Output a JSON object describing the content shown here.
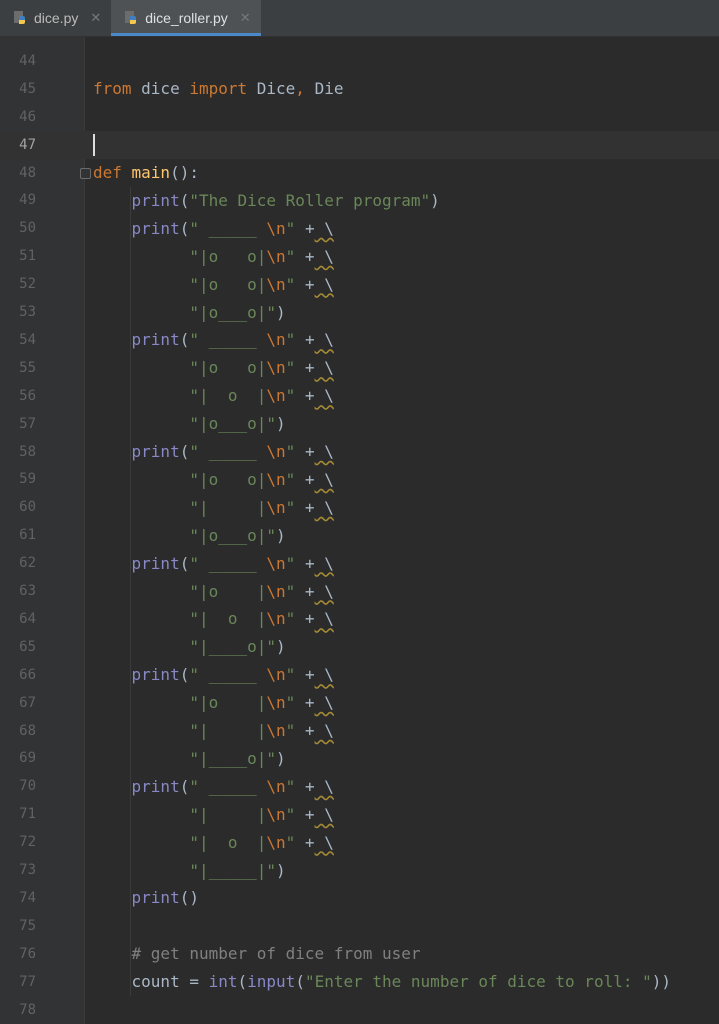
{
  "tabs": [
    {
      "label": "dice.py",
      "active": false,
      "icon": "python-file-icon"
    },
    {
      "label": "dice_roller.py",
      "active": true,
      "icon": "python-file-icon"
    }
  ],
  "colors": {
    "background": "#2b2b2b",
    "keyword": "#cc7832",
    "function": "#ffc66d",
    "builtin": "#8888c6",
    "string": "#6a8759",
    "comment": "#808080",
    "text": "#a9b7c6",
    "tab_accent": "#4a88c7"
  },
  "current_line": 47,
  "lines": [
    {
      "n": "44",
      "t": []
    },
    {
      "n": "45",
      "t": [
        [
          "kw",
          "from"
        ],
        [
          "plain",
          " dice "
        ],
        [
          "kw",
          "import"
        ],
        [
          "plain",
          " Dice"
        ],
        [
          "kw",
          ","
        ],
        [
          "plain",
          " Die"
        ]
      ]
    },
    {
      "n": "46",
      "t": []
    },
    {
      "n": "47",
      "t": []
    },
    {
      "n": "48",
      "t": [
        [
          "kw",
          "def "
        ],
        [
          "fn",
          "main"
        ],
        [
          "plain",
          "():"
        ]
      ]
    },
    {
      "n": "49",
      "t": [
        [
          "plain",
          "    "
        ],
        [
          "bi",
          "print"
        ],
        [
          "plain",
          "("
        ],
        [
          "str",
          "\"The Dice Roller program\""
        ],
        [
          "plain",
          ")"
        ]
      ]
    },
    {
      "n": "50",
      "t": [
        [
          "plain",
          "    "
        ],
        [
          "bi",
          "print"
        ],
        [
          "plain",
          "("
        ],
        [
          "str",
          "\" _____ "
        ],
        [
          "esc",
          "\\n"
        ],
        [
          "str",
          "\" "
        ],
        [
          "plain",
          "+"
        ],
        [
          "warn",
          " \\"
        ]
      ]
    },
    {
      "n": "51",
      "t": [
        [
          "plain",
          "          "
        ],
        [
          "str",
          "\"|o   o|"
        ],
        [
          "esc",
          "\\n"
        ],
        [
          "str",
          "\" "
        ],
        [
          "plain",
          "+"
        ],
        [
          "warn",
          " \\"
        ]
      ]
    },
    {
      "n": "52",
      "t": [
        [
          "plain",
          "          "
        ],
        [
          "str",
          "\"|o   o|"
        ],
        [
          "esc",
          "\\n"
        ],
        [
          "str",
          "\" "
        ],
        [
          "plain",
          "+"
        ],
        [
          "warn",
          " \\"
        ]
      ]
    },
    {
      "n": "53",
      "t": [
        [
          "plain",
          "          "
        ],
        [
          "str",
          "\"|o___o|\""
        ],
        [
          "plain",
          ")"
        ]
      ]
    },
    {
      "n": "54",
      "t": [
        [
          "plain",
          "    "
        ],
        [
          "bi",
          "print"
        ],
        [
          "plain",
          "("
        ],
        [
          "str",
          "\" _____ "
        ],
        [
          "esc",
          "\\n"
        ],
        [
          "str",
          "\" "
        ],
        [
          "plain",
          "+"
        ],
        [
          "warn",
          " \\"
        ]
      ]
    },
    {
      "n": "55",
      "t": [
        [
          "plain",
          "          "
        ],
        [
          "str",
          "\"|o   o|"
        ],
        [
          "esc",
          "\\n"
        ],
        [
          "str",
          "\" "
        ],
        [
          "plain",
          "+"
        ],
        [
          "warn",
          " \\"
        ]
      ]
    },
    {
      "n": "56",
      "t": [
        [
          "plain",
          "          "
        ],
        [
          "str",
          "\"|  o  |"
        ],
        [
          "esc",
          "\\n"
        ],
        [
          "str",
          "\" "
        ],
        [
          "plain",
          "+"
        ],
        [
          "warn",
          " \\"
        ]
      ]
    },
    {
      "n": "57",
      "t": [
        [
          "plain",
          "          "
        ],
        [
          "str",
          "\"|o___o|\""
        ],
        [
          "plain",
          ")"
        ]
      ]
    },
    {
      "n": "58",
      "t": [
        [
          "plain",
          "    "
        ],
        [
          "bi",
          "print"
        ],
        [
          "plain",
          "("
        ],
        [
          "str",
          "\" _____ "
        ],
        [
          "esc",
          "\\n"
        ],
        [
          "str",
          "\" "
        ],
        [
          "plain",
          "+"
        ],
        [
          "warn",
          " \\"
        ]
      ]
    },
    {
      "n": "59",
      "t": [
        [
          "plain",
          "          "
        ],
        [
          "str",
          "\"|o   o|"
        ],
        [
          "esc",
          "\\n"
        ],
        [
          "str",
          "\" "
        ],
        [
          "plain",
          "+"
        ],
        [
          "warn",
          " \\"
        ]
      ]
    },
    {
      "n": "60",
      "t": [
        [
          "plain",
          "          "
        ],
        [
          "str",
          "\"|     |"
        ],
        [
          "esc",
          "\\n"
        ],
        [
          "str",
          "\" "
        ],
        [
          "plain",
          "+"
        ],
        [
          "warn",
          " \\"
        ]
      ]
    },
    {
      "n": "61",
      "t": [
        [
          "plain",
          "          "
        ],
        [
          "str",
          "\"|o___o|\""
        ],
        [
          "plain",
          ")"
        ]
      ]
    },
    {
      "n": "62",
      "t": [
        [
          "plain",
          "    "
        ],
        [
          "bi",
          "print"
        ],
        [
          "plain",
          "("
        ],
        [
          "str",
          "\" _____ "
        ],
        [
          "esc",
          "\\n"
        ],
        [
          "str",
          "\" "
        ],
        [
          "plain",
          "+"
        ],
        [
          "warn",
          " \\"
        ]
      ]
    },
    {
      "n": "63",
      "t": [
        [
          "plain",
          "          "
        ],
        [
          "str",
          "\"|o    |"
        ],
        [
          "esc",
          "\\n"
        ],
        [
          "str",
          "\" "
        ],
        [
          "plain",
          "+"
        ],
        [
          "warn",
          " \\"
        ]
      ]
    },
    {
      "n": "64",
      "t": [
        [
          "plain",
          "          "
        ],
        [
          "str",
          "\"|  o  |"
        ],
        [
          "esc",
          "\\n"
        ],
        [
          "str",
          "\" "
        ],
        [
          "plain",
          "+"
        ],
        [
          "warn",
          " \\"
        ]
      ]
    },
    {
      "n": "65",
      "t": [
        [
          "plain",
          "          "
        ],
        [
          "str",
          "\"|____o|\""
        ],
        [
          "plain",
          ")"
        ]
      ]
    },
    {
      "n": "66",
      "t": [
        [
          "plain",
          "    "
        ],
        [
          "bi",
          "print"
        ],
        [
          "plain",
          "("
        ],
        [
          "str",
          "\" _____ "
        ],
        [
          "esc",
          "\\n"
        ],
        [
          "str",
          "\" "
        ],
        [
          "plain",
          "+"
        ],
        [
          "warn",
          " \\"
        ]
      ]
    },
    {
      "n": "67",
      "t": [
        [
          "plain",
          "          "
        ],
        [
          "str",
          "\"|o    |"
        ],
        [
          "esc",
          "\\n"
        ],
        [
          "str",
          "\" "
        ],
        [
          "plain",
          "+"
        ],
        [
          "warn",
          " \\"
        ]
      ]
    },
    {
      "n": "68",
      "t": [
        [
          "plain",
          "          "
        ],
        [
          "str",
          "\"|     |"
        ],
        [
          "esc",
          "\\n"
        ],
        [
          "str",
          "\" "
        ],
        [
          "plain",
          "+"
        ],
        [
          "warn",
          " \\"
        ]
      ]
    },
    {
      "n": "69",
      "t": [
        [
          "plain",
          "          "
        ],
        [
          "str",
          "\"|____o|\""
        ],
        [
          "plain",
          ")"
        ]
      ]
    },
    {
      "n": "70",
      "t": [
        [
          "plain",
          "    "
        ],
        [
          "bi",
          "print"
        ],
        [
          "plain",
          "("
        ],
        [
          "str",
          "\" _____ "
        ],
        [
          "esc",
          "\\n"
        ],
        [
          "str",
          "\" "
        ],
        [
          "plain",
          "+"
        ],
        [
          "warn",
          " \\"
        ]
      ]
    },
    {
      "n": "71",
      "t": [
        [
          "plain",
          "          "
        ],
        [
          "str",
          "\"|     |"
        ],
        [
          "esc",
          "\\n"
        ],
        [
          "str",
          "\" "
        ],
        [
          "plain",
          "+"
        ],
        [
          "warn",
          " \\"
        ]
      ]
    },
    {
      "n": "72",
      "t": [
        [
          "plain",
          "          "
        ],
        [
          "str",
          "\"|  o  |"
        ],
        [
          "esc",
          "\\n"
        ],
        [
          "str",
          "\" "
        ],
        [
          "plain",
          "+"
        ],
        [
          "warn",
          " \\"
        ]
      ]
    },
    {
      "n": "73",
      "t": [
        [
          "plain",
          "          "
        ],
        [
          "str",
          "\"|_____|\""
        ],
        [
          "plain",
          ")"
        ]
      ]
    },
    {
      "n": "74",
      "t": [
        [
          "plain",
          "    "
        ],
        [
          "bi",
          "print"
        ],
        [
          "plain",
          "()"
        ]
      ]
    },
    {
      "n": "75",
      "t": []
    },
    {
      "n": "76",
      "t": [
        [
          "plain",
          "    "
        ],
        [
          "cm",
          "# get number of dice from user"
        ]
      ]
    },
    {
      "n": "77",
      "t": [
        [
          "plain",
          "    count = "
        ],
        [
          "bi",
          "int"
        ],
        [
          "plain",
          "("
        ],
        [
          "bi",
          "input"
        ],
        [
          "plain",
          "("
        ],
        [
          "str",
          "\"Enter the number of dice to roll: \""
        ],
        [
          "plain",
          "))"
        ]
      ]
    },
    {
      "n": "78",
      "t": []
    }
  ]
}
